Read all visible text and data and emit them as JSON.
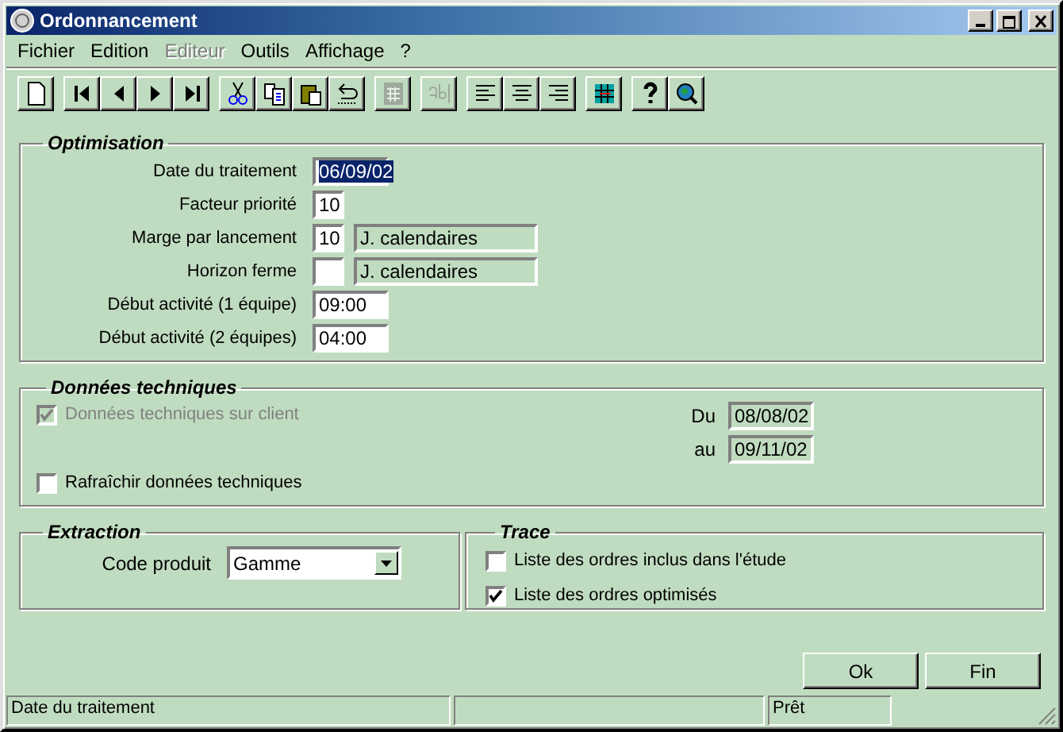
{
  "window": {
    "title": "Ordonnancement"
  },
  "menu": [
    {
      "label": "Fichier",
      "disabled": false
    },
    {
      "label": "Edition",
      "disabled": false
    },
    {
      "label": "Editeur",
      "disabled": true
    },
    {
      "label": "Outils",
      "disabled": false
    },
    {
      "label": "Affichage",
      "disabled": false
    },
    {
      "label": "?",
      "disabled": false
    }
  ],
  "toolbar": [
    {
      "kind": "new",
      "disabled": false
    },
    {
      "kind": "first",
      "disabled": false
    },
    {
      "kind": "prev",
      "disabled": false
    },
    {
      "kind": "next",
      "disabled": false
    },
    {
      "kind": "last",
      "disabled": false
    },
    {
      "kind": "cut",
      "disabled": false
    },
    {
      "kind": "copy",
      "disabled": false
    },
    {
      "kind": "paste",
      "disabled": false
    },
    {
      "kind": "undo",
      "disabled": false
    },
    {
      "kind": "calc",
      "disabled": true
    },
    {
      "kind": "textfield",
      "disabled": true
    },
    {
      "kind": "alignleft",
      "disabled": false
    },
    {
      "kind": "aligncenter",
      "disabled": false
    },
    {
      "kind": "alignright",
      "disabled": false
    },
    {
      "kind": "grid",
      "disabled": false
    },
    {
      "kind": "help",
      "disabled": false
    },
    {
      "kind": "globe",
      "disabled": false
    }
  ],
  "optimisation": {
    "title": "Optimisation",
    "rows": [
      {
        "label": "Date du traitement",
        "value": "06/09/02",
        "selected": true
      },
      {
        "label": "Facteur priorité",
        "value": "10",
        "selected": false
      },
      {
        "label": "Marge par lancement",
        "value": "10",
        "selected": false,
        "unit": "J. calendaires"
      },
      {
        "label": "Horizon ferme",
        "selected": false,
        "unit": "J. calendaires"
      },
      {
        "label": "Début activité (1 équipe)",
        "value": "09:00",
        "selected": false
      },
      {
        "label": "Début activité (2 équipes)",
        "value": "04:00",
        "selected": false
      }
    ]
  },
  "donnees_techniques": {
    "title": "Données techniques",
    "checkboxes": [
      {
        "label": "Données techniques sur client",
        "checked": true,
        "disabled": true
      },
      {
        "label": "Rafraîchir données techniques",
        "checked": false,
        "disabled": false
      }
    ],
    "dates": [
      {
        "label": "Du",
        "value": "08/08/02"
      },
      {
        "label": "au",
        "value": "09/11/02"
      }
    ]
  },
  "extraction": {
    "title": "Extraction",
    "label": "Code produit",
    "value": "Gamme"
  },
  "trace": {
    "title": "Trace",
    "checkboxes": [
      {
        "label": "Liste des ordres inclus dans l'étude",
        "checked": false
      },
      {
        "label": "Liste des ordres optimisés",
        "checked": true
      }
    ]
  },
  "buttons": [
    "Ok",
    "Fin"
  ],
  "status_bar": {
    "message": "Date du traitement",
    "state": "Prêt"
  }
}
